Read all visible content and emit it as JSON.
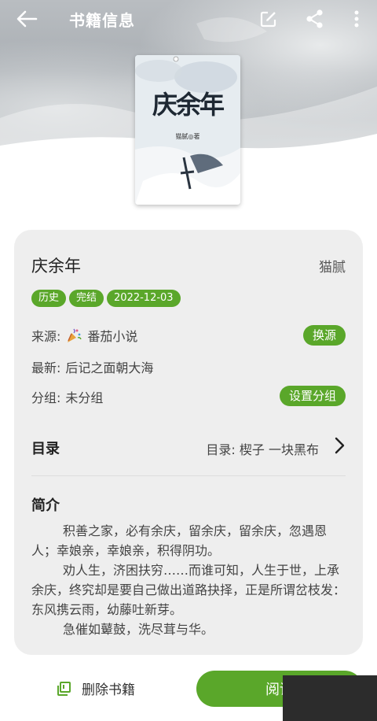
{
  "topbar": {
    "title": "书籍信息",
    "icons": [
      "back-arrow-icon",
      "edit-icon",
      "share-icon",
      "more-vert-icon"
    ]
  },
  "cover": {
    "title": "庆余年",
    "author_line": "猫腻◎著"
  },
  "book": {
    "name": "庆余年",
    "author": "猫腻",
    "tags": [
      "历史",
      "完结",
      "2022-12-03"
    ]
  },
  "info": {
    "source_label": "来源:",
    "source_value": "番茄小说",
    "source_button": "换源",
    "latest_label": "最新:",
    "latest_value": "后记之面朝大海",
    "group_label": "分组:",
    "group_value": "未分组",
    "group_button": "设置分组"
  },
  "toc": {
    "title": "目录",
    "latest": "目录: 楔子 一块黑布"
  },
  "intro": {
    "title": "简介",
    "paragraphs": [
      "积善之家，必有余庆，留余庆，留余庆，忽遇恩人；幸娘亲，幸娘亲，积得阴功。",
      "劝人生，济困扶穷……而谁可知，人生于世，上承余庆，终究却是要自己做出道路抉择，正是所谓岔枝发：东风携云雨，幼藤吐新芽。",
      "急催如鼙鼓，洗尽茸与华。"
    ]
  },
  "bottom": {
    "delete_label": "删除书籍",
    "read_label": "阅读"
  },
  "colors": {
    "accent": "#5aa72a",
    "card": "#eeeeee"
  }
}
